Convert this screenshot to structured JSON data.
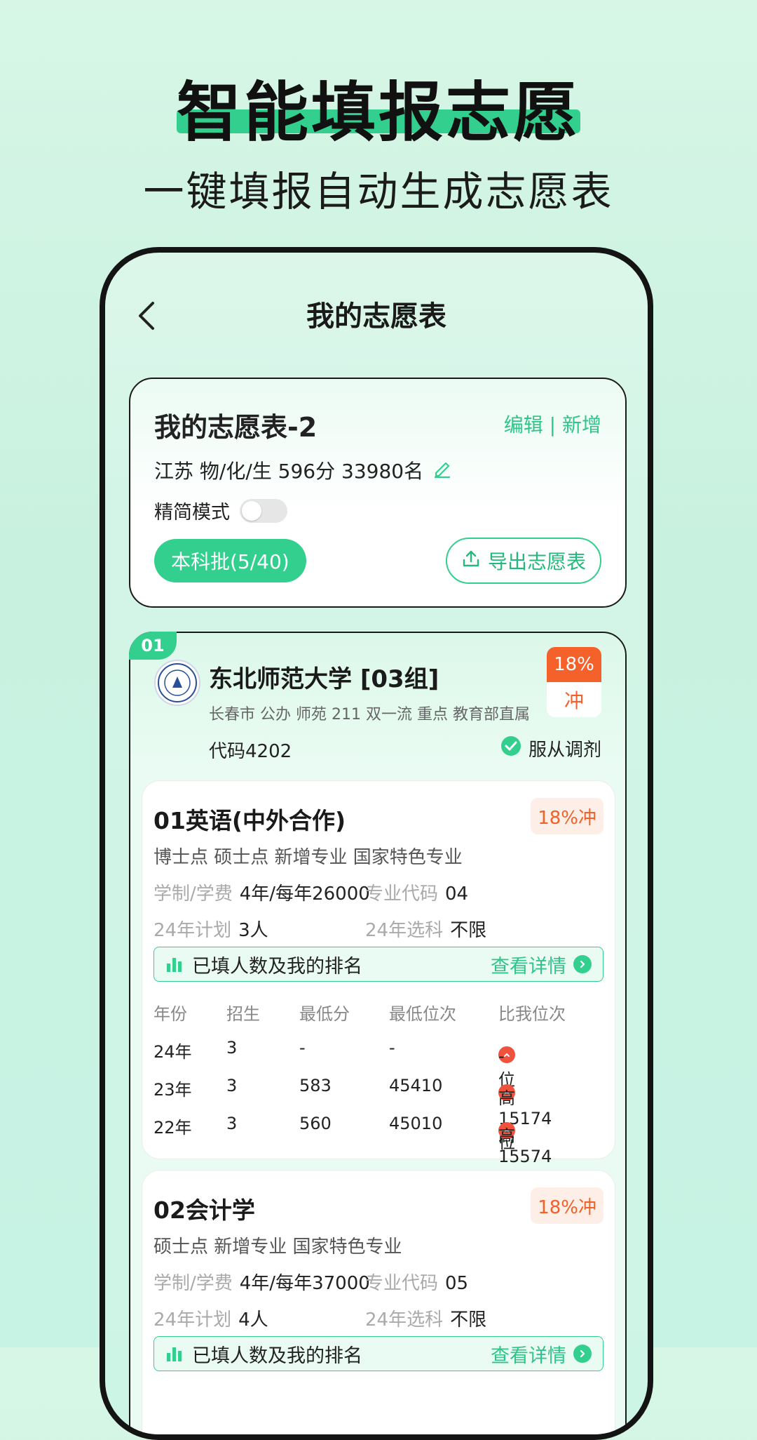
{
  "hero": {
    "title": "智能填报志愿",
    "subtitle": "一键填报自动生成志愿表"
  },
  "nav": {
    "title": "我的志愿表"
  },
  "summary": {
    "title": "我的志愿表-2",
    "edit_label": "编辑",
    "separator": "|",
    "add_label": "新增",
    "score_info": "江苏 物/化/生 596分 33980名",
    "mode_label": "精简模式",
    "batch_label": "本科批(5/40)",
    "export_label": "导出志愿表"
  },
  "university": {
    "index": "01",
    "name": "东北师范大学 [03组]",
    "tags": "长春市 公办 师苑 211 双一流 重点 教育部直属",
    "code": "代码4202",
    "obey_label": "服从调剂",
    "rate": "18%",
    "rate_type": "冲"
  },
  "majors": [
    {
      "title": "01英语(中外合作)",
      "badge": "18%冲",
      "features": "博士点 硕士点 新增专业 国家特色专业",
      "duration_key": "学制/学费",
      "duration_val": "4年/每年26000",
      "code_key": "专业代码",
      "code_val": "04",
      "plan_key": "24年计划",
      "plan_val": "3人",
      "subject_key": "24年选科",
      "subject_val": "不限",
      "rank_label": "已填人数及我的排名",
      "detail_label": "查看详情",
      "table_headers": [
        "年份",
        "招生",
        "最低分",
        "最低位次",
        "比我位次"
      ],
      "rows": [
        [
          "24年",
          "3",
          "-",
          "-",
          "-位"
        ],
        [
          "23年",
          "3",
          "583",
          "45410",
          "高15174位"
        ],
        [
          "22年",
          "3",
          "560",
          "45010",
          "高15574位"
        ]
      ]
    },
    {
      "title": "02会计学",
      "badge": "18%冲",
      "features": "硕士点 新增专业 国家特色专业",
      "duration_key": "学制/学费",
      "duration_val": "4年/每年37000",
      "code_key": "专业代码",
      "code_val": "05",
      "plan_key": "24年计划",
      "plan_val": "4人",
      "subject_key": "24年选科",
      "subject_val": "不限",
      "rank_label": "已填人数及我的排名",
      "detail_label": "查看详情"
    }
  ],
  "colors": {
    "accent": "#33cf8e",
    "warn": "#f5612b",
    "up": "#f0523e"
  }
}
